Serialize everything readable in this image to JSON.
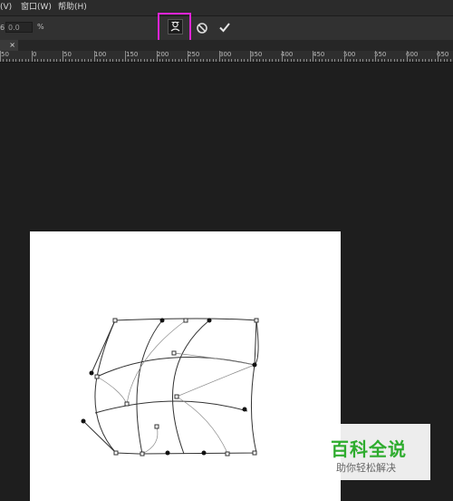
{
  "menubar": {
    "items": [
      {
        "label": "(V)"
      },
      {
        "label": "窗口(W)"
      },
      {
        "label": "帮助(H)"
      }
    ]
  },
  "options": {
    "field_label": "6",
    "field_value": "0.0",
    "unit": "%",
    "warp_mode_button": "warp-mode-icon",
    "cancel_button": "cancel-icon",
    "commit_button": "checkmark-icon",
    "highlight_color": "#e024d6"
  },
  "tab": {
    "close_label": "×"
  },
  "ruler": {
    "labels": [
      "50",
      "0",
      "50",
      "100",
      "150",
      "200",
      "250",
      "300",
      "350",
      "400",
      "450",
      "500",
      "550",
      "600",
      "650"
    ]
  },
  "watermark": {
    "title": "百科全说",
    "subtitle": "助你轻松解决",
    "brand_color": "#2eac2e"
  }
}
